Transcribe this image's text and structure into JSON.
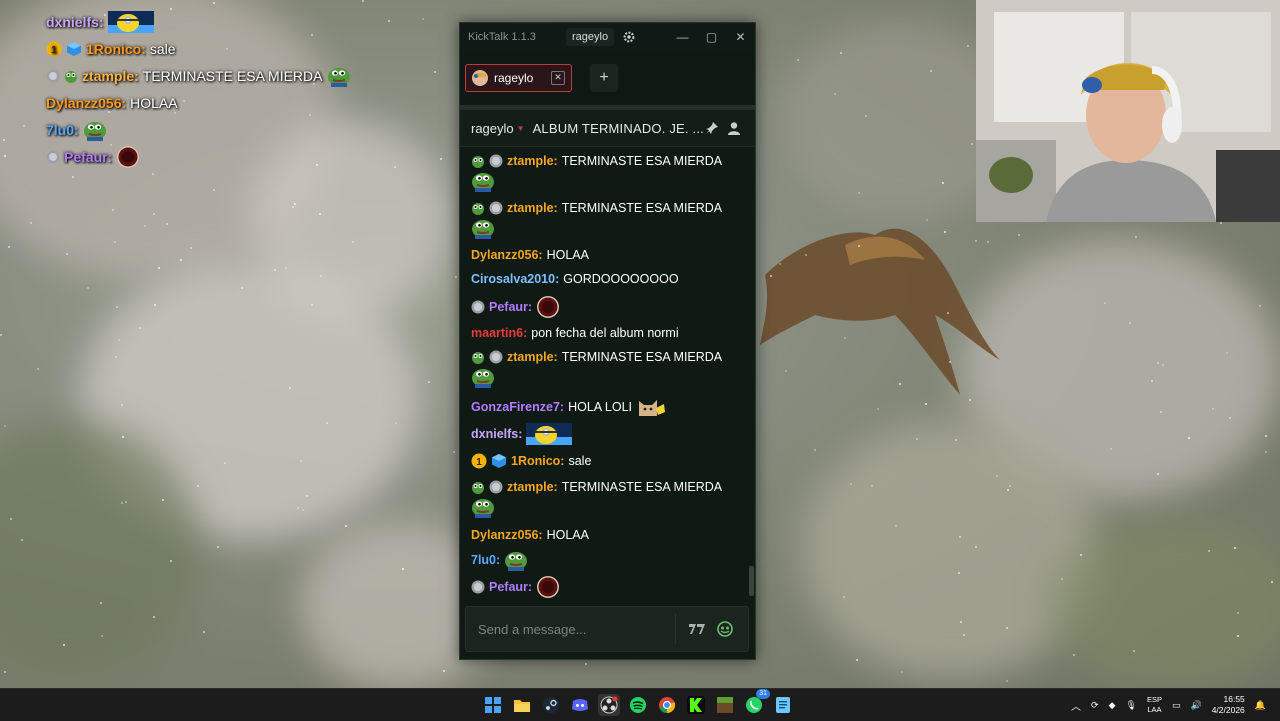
{
  "overlay_chat": [
    {
      "user": "dxnielfs",
      "user_color": "#c9a6ff",
      "text": "",
      "badges": [],
      "emote": "minion"
    },
    {
      "user": "1Ronico",
      "user_color": "#ff9a1f",
      "text": "sale",
      "badges": [
        "gold-one",
        "blue-cube"
      ],
      "emote": ""
    },
    {
      "user": "ztample",
      "user_color": "#ffb347",
      "text": "TERMINASTE ESA MIERDA",
      "badges": [
        "silver-circle",
        "green-pepe"
      ],
      "emote": "pepe"
    },
    {
      "user": "Dylanzz056",
      "user_color": "#ff9a1f",
      "text": "HOLAA",
      "badges": [],
      "emote": ""
    },
    {
      "user": "7lu0",
      "user_color": "#5aa8ff",
      "text": "",
      "badges": [],
      "emote": "pepe"
    },
    {
      "user": "Pefaur",
      "user_color": "#b37dff",
      "text": "",
      "badges": [
        "silver-circle"
      ],
      "emote": "donut"
    }
  ],
  "window": {
    "app_title": "KickTalk 1.1.3",
    "user": "rageylo",
    "min": "—",
    "max": "▢",
    "close": "✕"
  },
  "tabs": [
    {
      "label": "rageylo",
      "close": "✕",
      "active": true
    }
  ],
  "add_tab": "+",
  "channel": {
    "name": "rageylo",
    "title": "ALBUM TERMINADO. JE. ..."
  },
  "messages": [
    {
      "user": "ztample:",
      "color": "#f5a623",
      "text": "TERMINASTE ESA MIERDA",
      "badges": [
        "green-pepe",
        "silver-circle"
      ],
      "emote": "pepe"
    },
    {
      "user": "ztample:",
      "color": "#f5a623",
      "text": "TERMINASTE ESA MIERDA",
      "badges": [
        "green-pepe",
        "silver-circle"
      ],
      "emote": "pepe"
    },
    {
      "user": "Dylanzz056:",
      "color": "#f5a623",
      "text": "HOLAA",
      "badges": [],
      "emote": ""
    },
    {
      "user": "Cirosalva2010:",
      "color": "#7fc0ff",
      "text": "GORDOOOOOOOO",
      "badges": [],
      "emote": ""
    },
    {
      "user": "Pefaur:",
      "color": "#b47cff",
      "text": "",
      "badges": [
        "silver-circle"
      ],
      "emote": "donut"
    },
    {
      "user": "maartin6:",
      "color": "#e83a3a",
      "text": "pon fecha del album normi",
      "badges": [],
      "emote": ""
    },
    {
      "user": "ztample:",
      "color": "#f5a623",
      "text": "TERMINASTE ESA MIERDA",
      "badges": [
        "green-pepe",
        "silver-circle"
      ],
      "emote": "pepe"
    },
    {
      "user": "GonzaFirenze7:",
      "color": "#b47cff",
      "text": "HOLA LOLI",
      "badges": [],
      "emote": "cat"
    },
    {
      "user": "dxnielfs:",
      "color": "#c9a6ff",
      "text": "",
      "badges": [],
      "emote": "minion"
    },
    {
      "user": "1Ronico:",
      "color": "#f5a623",
      "text": "sale",
      "badges": [
        "gold-one",
        "blue-cube"
      ],
      "emote": ""
    },
    {
      "user": "ztample:",
      "color": "#f5a623",
      "text": "TERMINASTE ESA MIERDA",
      "badges": [
        "green-pepe",
        "silver-circle"
      ],
      "emote": "pepe"
    },
    {
      "user": "Dylanzz056:",
      "color": "#f5a623",
      "text": "HOLAA",
      "badges": [],
      "emote": ""
    },
    {
      "user": "7lu0:",
      "color": "#5aa8ff",
      "text": "",
      "badges": [],
      "emote": "pepe"
    },
    {
      "user": "Pefaur:",
      "color": "#b47cff",
      "text": "",
      "badges": [
        "silver-circle"
      ],
      "emote": "donut"
    }
  ],
  "input": {
    "placeholder": "Send a message...",
    "value": ""
  },
  "taskbar": {
    "apps": [
      "windows-start",
      "file-explorer",
      "steam",
      "discord",
      "obs",
      "spotify",
      "chrome",
      "kick",
      "minecraft",
      "whatsapp",
      "notepad"
    ],
    "whatsapp_badge": "31",
    "lang_top": "ESP",
    "lang_bottom": "LAA",
    "time": "16:55",
    "date": "4/2/2026"
  },
  "colors": {
    "accent_red": "#c13a3a",
    "kick_green": "#53fc18",
    "window_bg": "#0f1a15"
  }
}
